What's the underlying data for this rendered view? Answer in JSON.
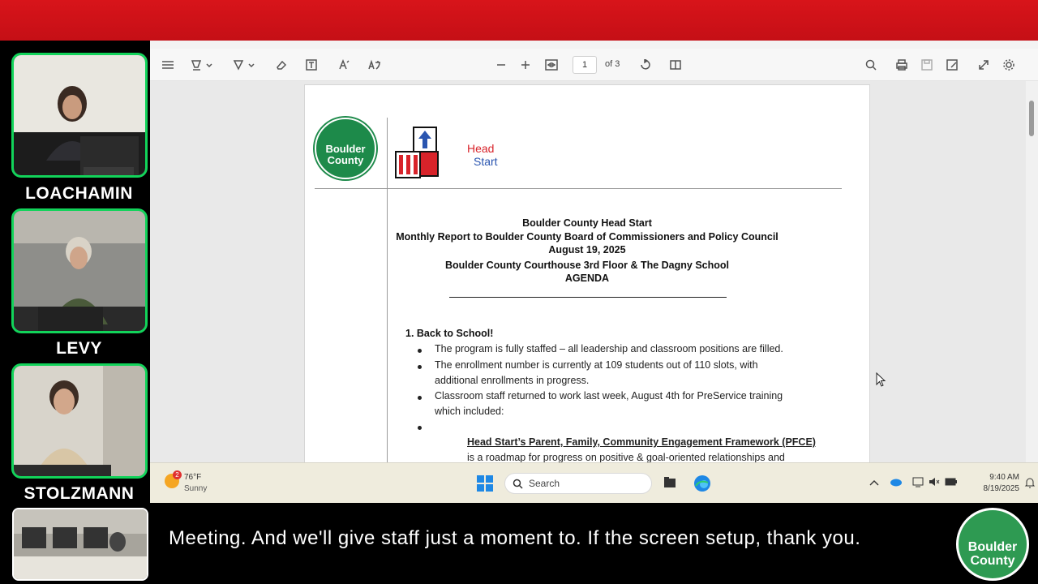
{
  "participants": [
    {
      "name": "LOACHAMIN"
    },
    {
      "name": "LEVY"
    },
    {
      "name": "STOLZMANN"
    }
  ],
  "pdf_toolbar": {
    "page_current": "1",
    "page_of": "of 3"
  },
  "document": {
    "logo_left": "Boulder County",
    "logo_right_line1": "Head",
    "logo_right_line2": "Start",
    "header_lines": [
      "Boulder County Head Start",
      "Monthly Report to Boulder County Board of Commissioners and Policy Council",
      "August 19, 2025",
      "Boulder County Courthouse 3rd Floor & The Dagny School",
      "AGENDA"
    ],
    "section1_title": "1. Back to School!",
    "bullets": [
      "The program is fully staffed – all leadership and classroom positions are filled.",
      "The enrollment number is currently at 109 students out of 110 slots, with",
      "additional enrollments in progress.",
      "Classroom staff returned to work last week, August 4th for PreService training",
      "which included:"
    ],
    "pfce_title": "Head Start’s Parent, Family, Community Engagement Framework (PFCE)",
    "pfce_text": "is a roadmap for progress on positive & goal-oriented relationships and"
  },
  "taskbar": {
    "weather_badge": "2",
    "weather_temp": "76°F",
    "weather_desc": "Sunny",
    "search_label": "Search",
    "time": "9:40 AM",
    "date": "8/19/2025"
  },
  "caption": {
    "text": "Meeting. And we'll give staff just a moment to. If the screen setup, thank you.",
    "logo_line1": "Boulder",
    "logo_line2": "County"
  },
  "colors": {
    "tile_border": "#12d35a",
    "top_bar": "#d8141a",
    "county_green": "#2e9a52"
  }
}
